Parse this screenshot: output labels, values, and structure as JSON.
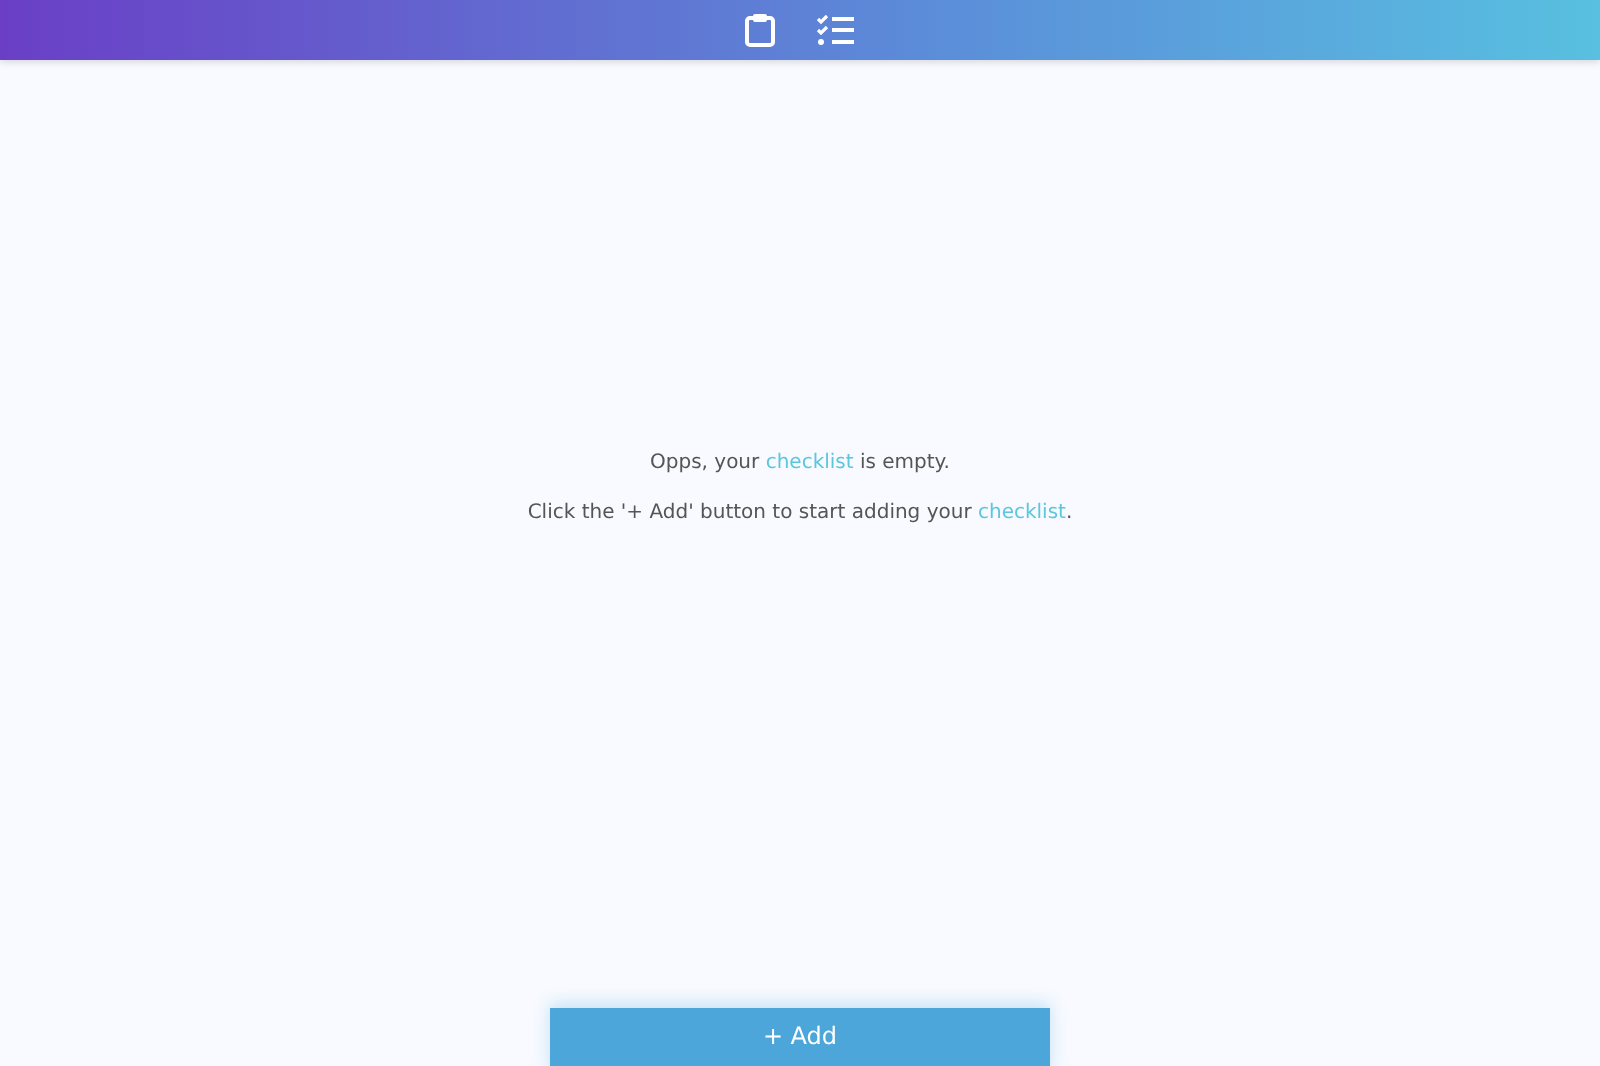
{
  "messages": [
    {
      "before": "Opps, your ",
      "highlight": "checklist",
      "after": " is empty."
    },
    {
      "before": "Click the '+ Add' button to start adding your ",
      "highlight": "checklist",
      "after": "."
    }
  ],
  "add_button": "+ Add"
}
